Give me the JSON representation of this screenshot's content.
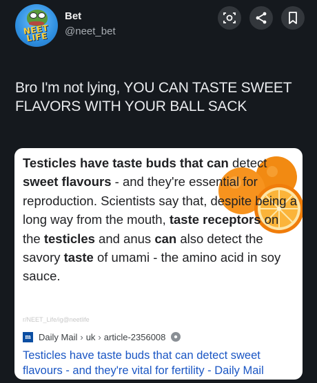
{
  "header": {
    "name": "Bet",
    "handle": "@neet_bet",
    "avatar_badge_line1": "NEET",
    "avatar_badge_line2": "LIFE",
    "buttons": [
      {
        "icon": "lens-icon"
      },
      {
        "icon": "share-icon"
      },
      {
        "icon": "bookmark-icon"
      }
    ]
  },
  "post": {
    "text": "Bro I'm not lying, YOU CAN TASTE SWEET FLAVORS WITH YOUR BALL SACK"
  },
  "card": {
    "snippet_segments": [
      {
        "t": "Testicles have taste buds that can",
        "b": true
      },
      {
        "t": " detect ",
        "b": false
      },
      {
        "t": "sweet flavours",
        "b": true
      },
      {
        "t": " - and they're essential for reproduction. Scientists say that, despite being a long way from the mouth, ",
        "b": false
      },
      {
        "t": "taste receptors",
        "b": true
      },
      {
        "t": " on the ",
        "b": false
      },
      {
        "t": "testicles",
        "b": true
      },
      {
        "t": " and anus ",
        "b": false
      },
      {
        "t": "can",
        "b": true
      },
      {
        "t": " also detect the savory ",
        "b": false
      },
      {
        "t": "taste",
        "b": true
      },
      {
        "t": " of umami - the amino acid in soy sauce.",
        "b": false
      }
    ],
    "watermark": "r/NEET_Life/ig@neetlife",
    "source": {
      "logo_letter": "m",
      "site": "Daily Mail",
      "path1": "uk",
      "path2": "article-2356008"
    },
    "result_title": "Testicles have taste buds that can detect sweet flavours - and they're vital for fertility - Daily Mail"
  },
  "colors": {
    "background": "#15191e",
    "link": "#1a56c4",
    "orange": "#f7931e"
  }
}
